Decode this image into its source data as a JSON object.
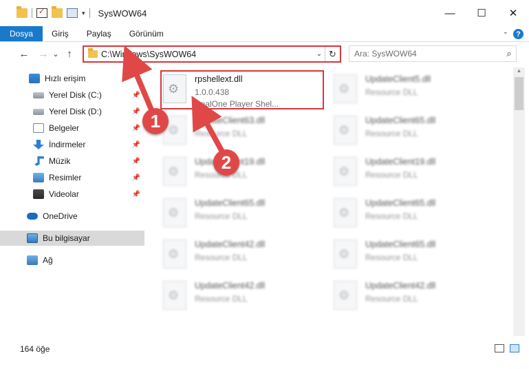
{
  "window": {
    "title": "SysWOW64",
    "controls": {
      "minimize": "—",
      "maximize": "☐",
      "close": "✕"
    },
    "accent": "#1979ca"
  },
  "ribbon": {
    "tabs": [
      "Dosya",
      "Giriş",
      "Paylaş",
      "Görünüm"
    ],
    "help": "?"
  },
  "nav": {
    "back": "←",
    "forward": "→",
    "recent": "⌄",
    "up": "↑",
    "address": "C:\\Windows\\SysWOW64",
    "refresh": "↻",
    "search_placeholder": "Ara: SysWOW64",
    "search_icon": "⌕"
  },
  "sidebar": {
    "items": [
      {
        "label": "Hızlı erişim",
        "icon": "star-icon"
      },
      {
        "label": "Yerel Disk (C:)",
        "icon": "drive-icon",
        "pinned": true
      },
      {
        "label": "Yerel Disk (D:)",
        "icon": "drive-icon",
        "pinned": true
      },
      {
        "label": "Belgeler",
        "icon": "documents-icon",
        "pinned": true
      },
      {
        "label": "İndirmeler",
        "icon": "download-icon",
        "pinned": true
      },
      {
        "label": "Müzik",
        "icon": "music-icon",
        "pinned": true
      },
      {
        "label": "Resimler",
        "icon": "pictures-icon",
        "pinned": true
      },
      {
        "label": "Videolar",
        "icon": "video-icon",
        "pinned": true
      },
      {
        "label": "OneDrive",
        "icon": "cloud-icon"
      },
      {
        "label": "Bu bilgisayar",
        "icon": "computer-icon",
        "selected": true
      },
      {
        "label": "Ağ",
        "icon": "network-icon"
      }
    ],
    "pin_glyph": "📌"
  },
  "files": {
    "highlighted": {
      "name": "rpshellext.dll",
      "version": "1.0.0.438",
      "description": "RealOne Player Shel..."
    },
    "left_column": [
      {
        "name": "UpdateClient63.dll",
        "type": "Resource DLL"
      },
      {
        "name": "UpdateClient19.dll",
        "type": "Resource DLL"
      },
      {
        "name": "UpdateClient65.dll",
        "type": "Resource DLL"
      },
      {
        "name": "UpdateClient42.dll",
        "type": "Resource DLL"
      },
      {
        "name": "UpdateClient42.dll",
        "type": "Resource DLL"
      }
    ],
    "right_column": [
      {
        "name": "UpdateClient5.dll",
        "type": "Resource DLL"
      },
      {
        "name": "UpdateClient65.dll",
        "type": "Resource DLL"
      },
      {
        "name": "UpdateClient19.dll",
        "type": "Resource DLL"
      },
      {
        "name": "UpdateClient65.dll",
        "type": "Resource DLL"
      },
      {
        "name": "UpdateClient65.dll",
        "type": "Resource DLL"
      },
      {
        "name": "UpdateClient42.dll",
        "type": "Resource DLL"
      }
    ]
  },
  "status": {
    "item_count": "164 öğe"
  },
  "callouts": {
    "one": "1",
    "two": "2",
    "color": "#e04848"
  }
}
